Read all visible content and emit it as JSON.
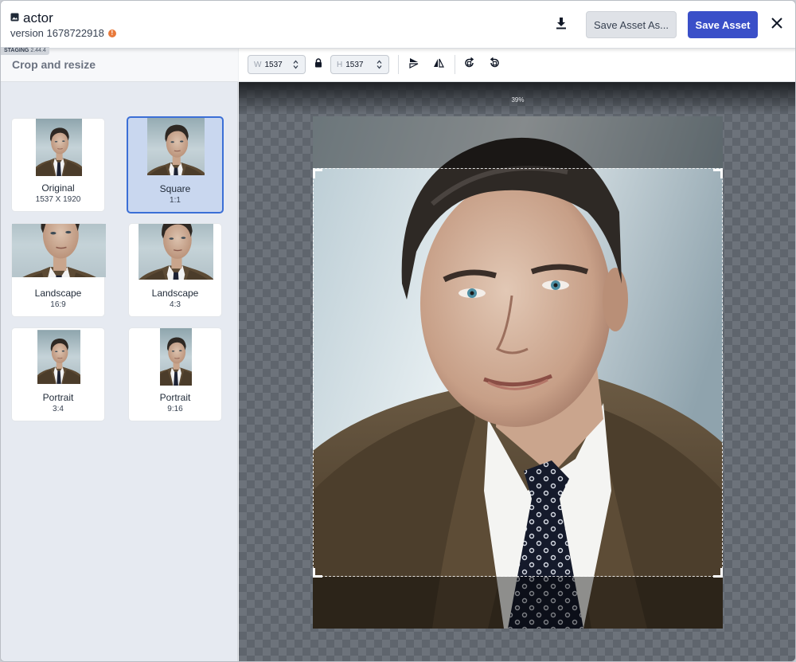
{
  "header": {
    "title": "actor",
    "version": "version 1678722918",
    "warn_glyph": "!",
    "save_as_label": "Save Asset As...",
    "save_label": "Save Asset",
    "staging_label": "STAGING",
    "staging_version": "2.44.4"
  },
  "panel": {
    "title": "Crop and resize",
    "presets": [
      {
        "label": "Original",
        "sub": "1537 X 1920",
        "selected": false
      },
      {
        "label": "Square",
        "sub": "1:1",
        "selected": true
      },
      {
        "label": "Landscape",
        "sub": "16:9",
        "selected": false
      },
      {
        "label": "Landscape",
        "sub": "4:3",
        "selected": false
      },
      {
        "label": "Portrait",
        "sub": "3:4",
        "selected": false
      },
      {
        "label": "Portrait",
        "sub": "9:16",
        "selected": false
      }
    ]
  },
  "toolbar": {
    "width_label": "W",
    "width_value": "1537",
    "height_label": "H",
    "height_value": "1537"
  },
  "canvas": {
    "zoom": "39%"
  },
  "icons": [
    "image-icon",
    "download-icon",
    "close-icon",
    "lock-icon",
    "flip-horizontal-icon",
    "flip-vertical-icon",
    "rotate-clockwise-icon",
    "rotate-counterclockwise-icon",
    "spinner-arrows-icon"
  ],
  "colors": {
    "primary": "#3a4fc8",
    "selected_border": "#3b6fd6",
    "selected_bg": "#c9d7ef",
    "warning": "#e8793a"
  }
}
